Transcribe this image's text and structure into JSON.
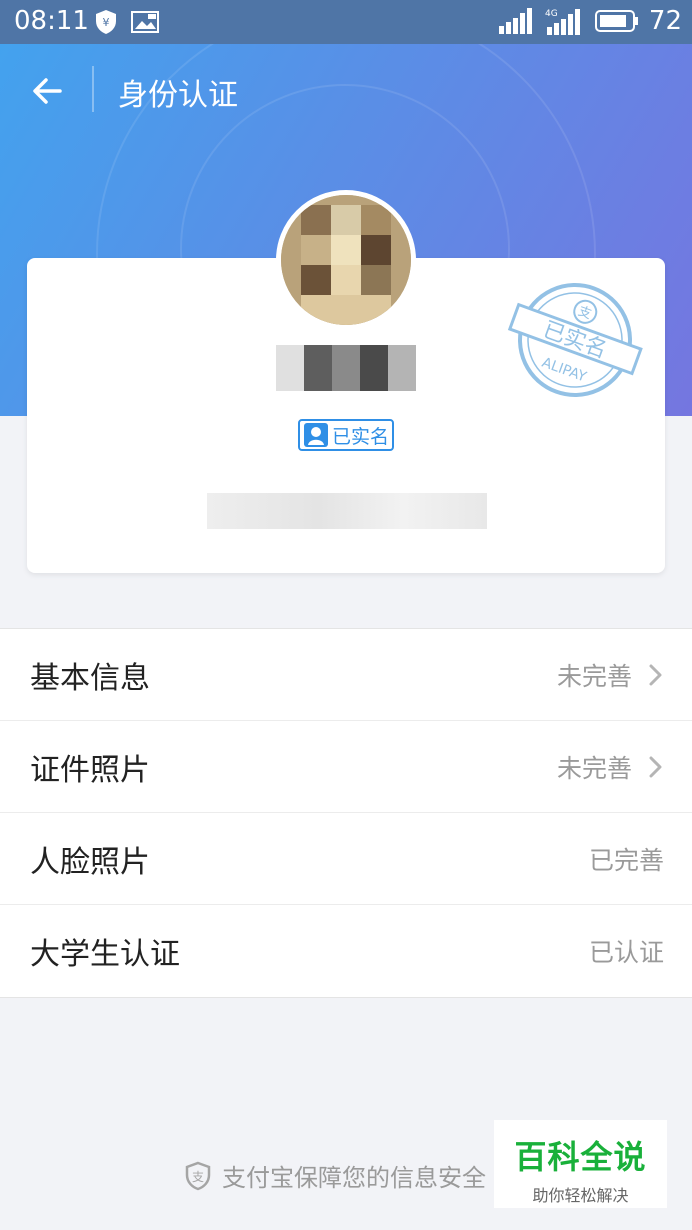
{
  "status_bar": {
    "time": "08:11",
    "battery": "72",
    "network_label": "4G"
  },
  "header": {
    "title": "身份认证"
  },
  "card": {
    "verified_badge": "已实名",
    "stamp_text": "已实名",
    "stamp_brand": "ALIPAY",
    "stamp_logo": "支"
  },
  "rows": [
    {
      "label": "基本信息",
      "value": "未完善",
      "has_chevron": true
    },
    {
      "label": "证件照片",
      "value": "未完善",
      "has_chevron": true
    },
    {
      "label": "人脸照片",
      "value": "已完善",
      "has_chevron": false
    },
    {
      "label": "大学生认证",
      "value": "已认证",
      "has_chevron": false
    }
  ],
  "footer": {
    "note": "支付宝保障您的信息安全",
    "logo_char": "支"
  },
  "watermark": {
    "title": "百科全说",
    "subtitle": "助你轻松解决"
  },
  "colors": {
    "accent": "#2f8fe6",
    "header_start": "#43a2ee",
    "header_end": "#7576e0",
    "watermark_green": "#19b03a"
  }
}
